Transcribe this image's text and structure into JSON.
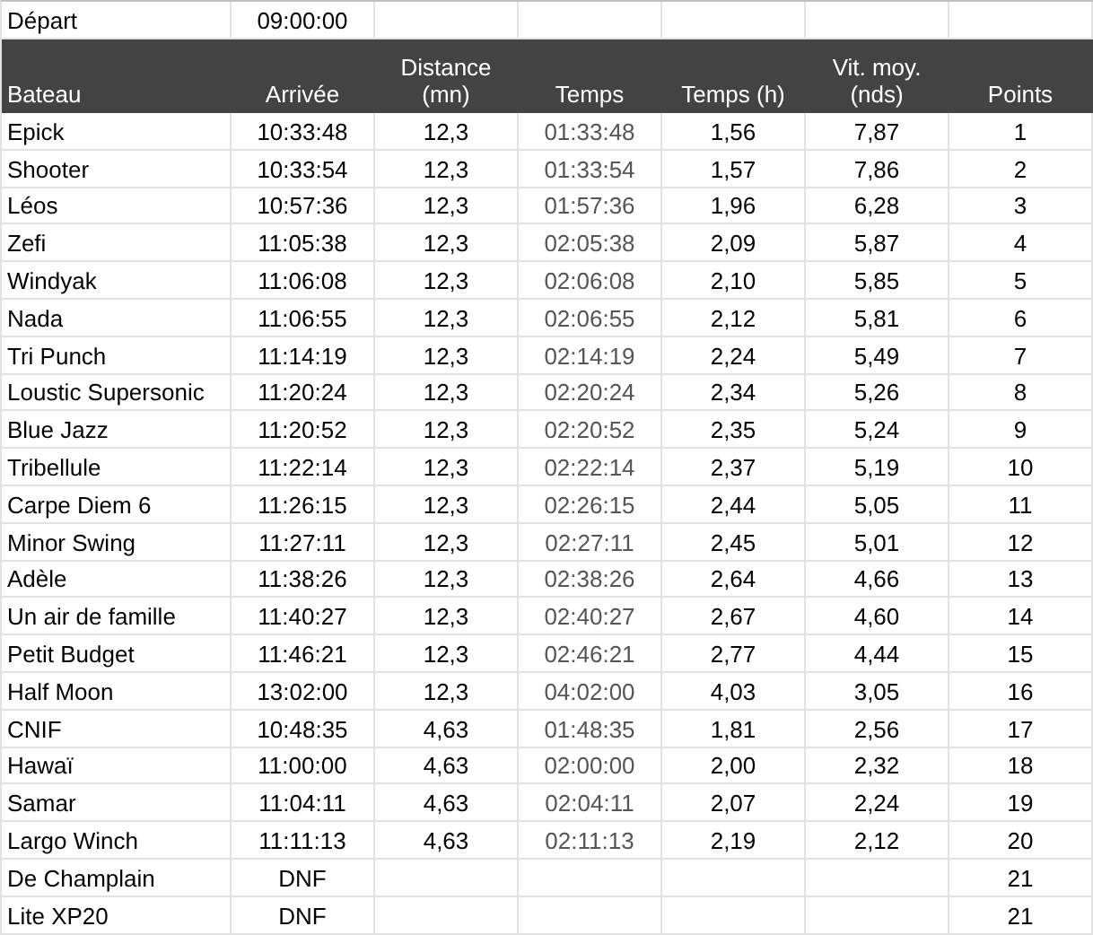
{
  "start": {
    "label": "Départ",
    "time": "09:00:00"
  },
  "columns": [
    "Bateau",
    "Arrivée",
    "Distance\n(mn)",
    "Temps",
    "Temps (h)",
    "Vit. moy.\n(nds)",
    "Points"
  ],
  "rows": [
    [
      "Epick",
      "10:33:48",
      "12,3",
      "01:33:48",
      "1,56",
      "7,87",
      "1"
    ],
    [
      "Shooter",
      "10:33:54",
      "12,3",
      "01:33:54",
      "1,57",
      "7,86",
      "2"
    ],
    [
      "Léos",
      "10:57:36",
      "12,3",
      "01:57:36",
      "1,96",
      "6,28",
      "3"
    ],
    [
      "Zefi",
      "11:05:38",
      "12,3",
      "02:05:38",
      "2,09",
      "5,87",
      "4"
    ],
    [
      "Windyak",
      "11:06:08",
      "12,3",
      "02:06:08",
      "2,10",
      "5,85",
      "5"
    ],
    [
      "Nada",
      "11:06:55",
      "12,3",
      "02:06:55",
      "2,12",
      "5,81",
      "6"
    ],
    [
      "Tri Punch",
      "11:14:19",
      "12,3",
      "02:14:19",
      "2,24",
      "5,49",
      "7"
    ],
    [
      "Loustic Supersonic",
      "11:20:24",
      "12,3",
      "02:20:24",
      "2,34",
      "5,26",
      "8"
    ],
    [
      "Blue Jazz",
      "11:20:52",
      "12,3",
      "02:20:52",
      "2,35",
      "5,24",
      "9"
    ],
    [
      "Tribellule",
      "11:22:14",
      "12,3",
      "02:22:14",
      "2,37",
      "5,19",
      "10"
    ],
    [
      "Carpe Diem 6",
      "11:26:15",
      "12,3",
      "02:26:15",
      "2,44",
      "5,05",
      "11"
    ],
    [
      "Minor Swing",
      "11:27:11",
      "12,3",
      "02:27:11",
      "2,45",
      "5,01",
      "12"
    ],
    [
      "Adèle",
      "11:38:26",
      "12,3",
      "02:38:26",
      "2,64",
      "4,66",
      "13"
    ],
    [
      "Un air de famille",
      "11:40:27",
      "12,3",
      "02:40:27",
      "2,67",
      "4,60",
      "14"
    ],
    [
      "Petit Budget",
      "11:46:21",
      "12,3",
      "02:46:21",
      "2,77",
      "4,44",
      "15"
    ],
    [
      "Half Moon",
      "13:02:00",
      "12,3",
      "04:02:00",
      "4,03",
      "3,05",
      "16"
    ],
    [
      "CNIF",
      "10:48:35",
      "4,63",
      "01:48:35",
      "1,81",
      "2,56",
      "17"
    ],
    [
      "Hawaï",
      "11:00:00",
      "4,63",
      "02:00:00",
      "2,00",
      "2,32",
      "18"
    ],
    [
      "Samar",
      "11:04:11",
      "4,63",
      "02:04:11",
      "2,07",
      "2,24",
      "19"
    ],
    [
      "Largo Winch",
      "11:11:13",
      "4,63",
      "02:11:13",
      "2,19",
      "2,12",
      "20"
    ],
    [
      "De Champlain",
      "DNF",
      null,
      null,
      null,
      null,
      "21"
    ],
    [
      "Lite XP20",
      "DNF",
      null,
      null,
      null,
      null,
      "21"
    ]
  ]
}
